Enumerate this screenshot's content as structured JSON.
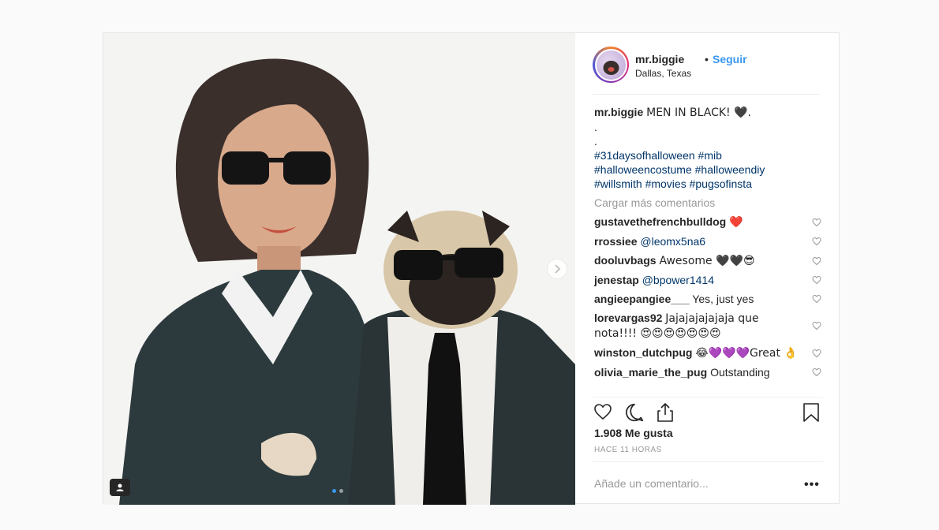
{
  "post": {
    "username": "mr.biggie",
    "bullet": "•",
    "follow_label": "Seguir",
    "location": "Dallas, Texas",
    "caption": {
      "username": "mr.biggie",
      "text": "MEN IN BLACK! 🖤.",
      "lines": [
        ".",
        "."
      ],
      "hashtags_line1": "#31daysofhalloween #mib",
      "hashtags_line2": "#halloweencostume #halloweendiy",
      "hashtags_line3": "#willsmith #movies #pugsofinsta"
    },
    "load_more_label": "Cargar más comentarios",
    "comments": [
      {
        "user": "gustavethefrenchbulldog",
        "text": "❤️"
      },
      {
        "user": "rrossiee",
        "mention": "@leomx5na6",
        "text": ""
      },
      {
        "user": "dooluvbags",
        "text": "Awesome 🖤🖤😎"
      },
      {
        "user": "jenestap",
        "mention": "@bpower1414",
        "text": ""
      },
      {
        "user": "angieepangiee___",
        "text": "Yes, just yes"
      },
      {
        "user": "lorevargas92",
        "text": "Jajajajajajaja que nota!!!! 😍😍😍😍😍😍😍"
      },
      {
        "user": "winston_dutchpug",
        "text": "😂💜💜💜Great 👌"
      },
      {
        "user": "olivia_marie_the_pug",
        "text": "Outstanding"
      }
    ],
    "likes": "1.908 Me gusta",
    "time": "HACE 11 HORAS",
    "add_comment_placeholder": "Añade un comentario...",
    "more_label": "•••"
  },
  "colors": {
    "link_blue": "#3897f0",
    "hashtag": "#003569",
    "muted": "#999999"
  },
  "icons": {
    "like": "heart-icon",
    "comment": "comment-icon",
    "share": "share-icon",
    "save": "bookmark-icon",
    "next": "chevron-right-icon",
    "tag": "user-tag-icon"
  }
}
